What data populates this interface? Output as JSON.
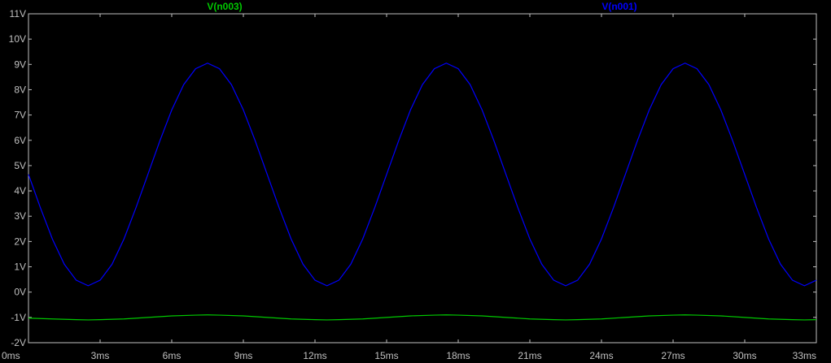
{
  "chart_data": {
    "type": "line",
    "title": "",
    "xlabel": "",
    "ylabel": "",
    "grid": false,
    "legend_placement": "top",
    "xlim": [
      0,
      33
    ],
    "ylim": [
      -2,
      11
    ],
    "x_ticks": [
      0,
      3,
      6,
      9,
      12,
      15,
      18,
      21,
      24,
      27,
      30,
      33
    ],
    "x_tick_labels": [
      "0ms",
      "3ms",
      "6ms",
      "9ms",
      "12ms",
      "15ms",
      "18ms",
      "21ms",
      "24ms",
      "27ms",
      "30ms",
      "33ms"
    ],
    "y_ticks": [
      -2,
      -1,
      0,
      1,
      2,
      3,
      4,
      5,
      6,
      7,
      8,
      9,
      10,
      11
    ],
    "y_tick_labels": [
      "-2V",
      "-1V",
      "0V",
      "1V",
      "2V",
      "3V",
      "4V",
      "5V",
      "6V",
      "7V",
      "8V",
      "9V",
      "10V",
      "11V"
    ],
    "series": [
      {
        "name": "V(n003)",
        "color": "#00c800",
        "x": [
          0,
          1,
          2,
          2.5,
          3,
          4,
          5,
          6,
          7,
          7.5,
          8,
          9,
          10,
          11,
          12,
          12.5,
          13,
          14,
          15,
          16,
          17,
          17.5,
          18,
          19,
          20,
          21,
          22,
          22.5,
          23,
          24,
          25,
          26,
          27,
          27.5,
          28,
          29,
          30,
          31,
          32,
          32.5,
          33
        ],
        "y": [
          -1.03,
          -1.06,
          -1.09,
          -1.1,
          -1.09,
          -1.06,
          -1.0,
          -0.94,
          -0.91,
          -0.9,
          -0.91,
          -0.94,
          -1.0,
          -1.06,
          -1.09,
          -1.1,
          -1.09,
          -1.06,
          -1.0,
          -0.94,
          -0.91,
          -0.9,
          -0.91,
          -0.94,
          -1.0,
          -1.06,
          -1.09,
          -1.1,
          -1.09,
          -1.06,
          -1.0,
          -0.94,
          -0.91,
          -0.9,
          -0.91,
          -0.94,
          -1.0,
          -1.06,
          -1.09,
          -1.1,
          -1.09
        ]
      },
      {
        "name": "V(n001)",
        "color": "#0000ff",
        "x": [
          0,
          0.5,
          1,
          1.5,
          2,
          2.5,
          3,
          3.5,
          4,
          4.5,
          5,
          5.5,
          6,
          6.5,
          7,
          7.5,
          8,
          8.5,
          9,
          9.5,
          10,
          10.5,
          11,
          11.5,
          12,
          12.5,
          13,
          13.5,
          14,
          14.5,
          15,
          15.5,
          16,
          16.5,
          17,
          17.5,
          18,
          18.5,
          19,
          19.5,
          20,
          20.5,
          21,
          21.5,
          22,
          22.5,
          23,
          23.5,
          24,
          24.5,
          25,
          25.5,
          26,
          26.5,
          27,
          27.5,
          28,
          28.5,
          29,
          29.5,
          30,
          30.5,
          31,
          31.5,
          32,
          32.5,
          33
        ],
        "y": [
          4.65,
          3.33,
          2.1,
          1.1,
          0.47,
          0.25,
          0.47,
          1.1,
          2.1,
          3.33,
          4.65,
          5.97,
          7.2,
          8.2,
          8.83,
          9.05,
          8.83,
          8.2,
          7.2,
          5.97,
          4.65,
          3.33,
          2.1,
          1.1,
          0.47,
          0.25,
          0.47,
          1.1,
          2.1,
          3.33,
          4.65,
          5.97,
          7.2,
          8.2,
          8.83,
          9.05,
          8.83,
          8.2,
          7.2,
          5.97,
          4.65,
          3.33,
          2.1,
          1.1,
          0.47,
          0.25,
          0.47,
          1.1,
          2.1,
          3.33,
          4.65,
          5.97,
          7.2,
          8.2,
          8.83,
          9.05,
          8.83,
          8.2,
          7.2,
          5.97,
          4.65,
          3.33,
          2.1,
          1.1,
          0.47,
          0.25,
          0.47
        ]
      }
    ]
  }
}
